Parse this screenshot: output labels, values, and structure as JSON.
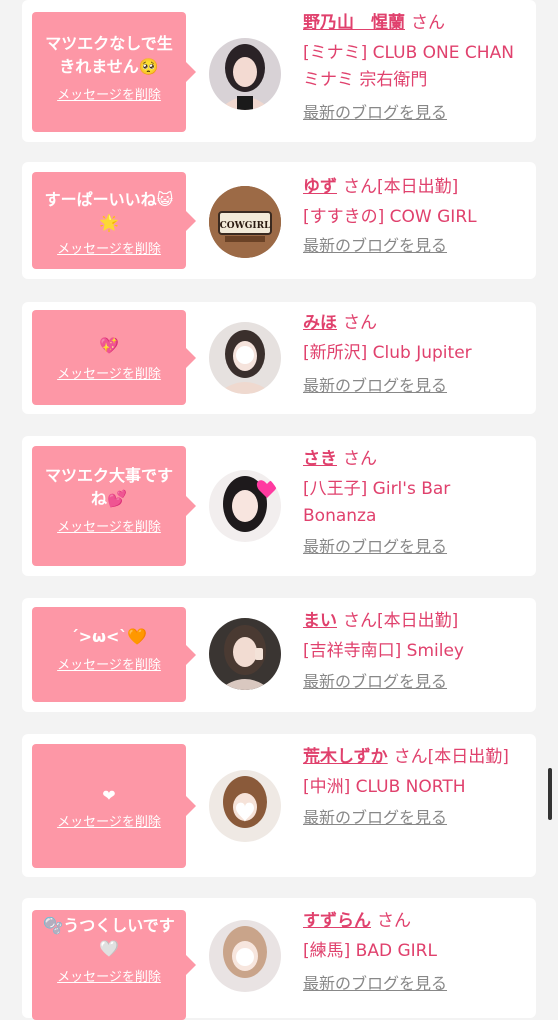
{
  "cards": [
    {
      "message": "マツエクなしで生きれません🥺",
      "delete_label": "メッセージを削除",
      "name": "野乃山　惺蘭",
      "honorific": "さん",
      "status": "",
      "shop": "[ミナミ] CLUB ONE CHAN ミナミ 宗右衛門",
      "blog_label": "最新のブログを見る"
    },
    {
      "message": "すーぱーいいね😺🌟",
      "delete_label": "メッセージを削除",
      "name": "ゆず",
      "honorific": "さん",
      "status": "[本日出勤]",
      "shop": "[すすきの] COW GIRL",
      "blog_label": "最新のブログを見る"
    },
    {
      "message": "💖",
      "delete_label": "メッセージを削除",
      "name": "みほ",
      "honorific": "さん",
      "status": "",
      "shop": "[新所沢] Club Jupiter",
      "blog_label": "最新のブログを見る"
    },
    {
      "message": "マツエク大事ですね💕",
      "delete_label": "メッセージを削除",
      "name": "さき",
      "honorific": "さん",
      "status": "",
      "shop": "[八王子] Girl's Bar Bonanza",
      "blog_label": "最新のブログを見る"
    },
    {
      "message": "´>ω<`🧡",
      "delete_label": "メッセージを削除",
      "name": "まい",
      "honorific": "さん",
      "status": "[本日出勤]",
      "shop": "[吉祥寺南口] Smiley",
      "blog_label": "最新のブログを見る"
    },
    {
      "message": "❤",
      "delete_label": "メッセージを削除",
      "name": "荒木しずか",
      "honorific": "さん",
      "status": "[本日出勤]",
      "shop": "[中洲] CLUB NORTH",
      "blog_label": "最新のブログを見る"
    },
    {
      "message": "🫧うつくしいです🤍",
      "delete_label": "メッセージを削除",
      "name": "すずらん",
      "honorific": "さん",
      "status": "",
      "shop": "[練馬] BAD GIRL",
      "blog_label": "最新のブログを見る"
    }
  ],
  "avatar_labels": {
    "cowgirl": "COWGIRL"
  },
  "colors": {
    "accent": "#e0416d",
    "bubble": "#fd97a6",
    "link_gray": "#888888",
    "background": "#f3f3f3"
  }
}
